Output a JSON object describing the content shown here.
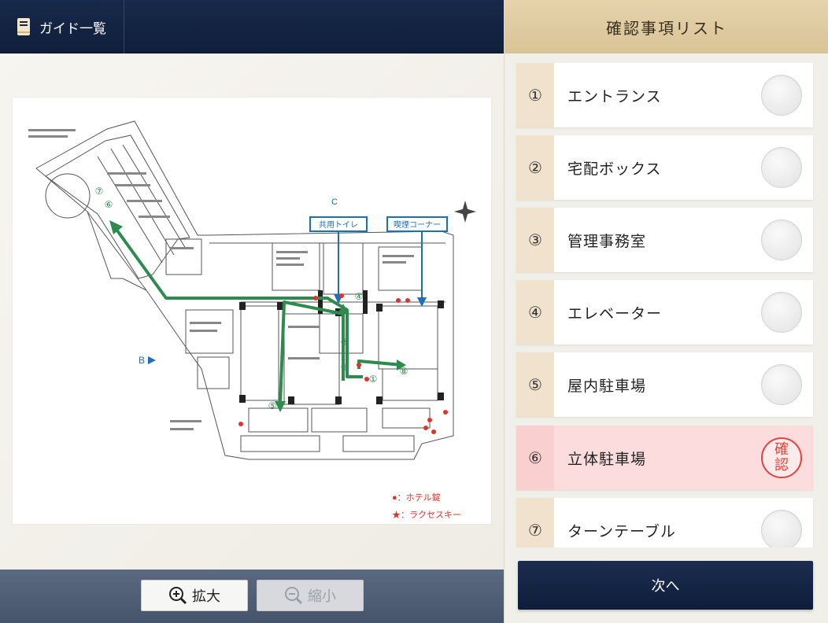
{
  "left": {
    "guide_button": "ガイド一覧",
    "guide_icon": "book-icon",
    "zoom_in": "拡大",
    "zoom_out": "縮小"
  },
  "map": {
    "label_c": "C",
    "label_b": "B",
    "toilet": "共用トイレ",
    "smoking": "喫煙コーナー",
    "legend_hotel": "●：ホテル錠",
    "legend_raku": "★：ラクセスキー",
    "markers": [
      "①",
      "②",
      "③",
      "④",
      "⑤",
      "⑥",
      "⑦",
      "⑧"
    ],
    "accent_green": "#2e8b4e",
    "accent_blue": "#1d6fb8",
    "accent_red": "#e0332b"
  },
  "right": {
    "title": "確認事項リスト",
    "items": [
      {
        "num": "①",
        "label": "エントランス",
        "checked": false
      },
      {
        "num": "②",
        "label": "宅配ボックス",
        "checked": false
      },
      {
        "num": "③",
        "label": "管理事務室",
        "checked": false
      },
      {
        "num": "④",
        "label": "エレベーター",
        "checked": false
      },
      {
        "num": "⑤",
        "label": "屋内駐車場",
        "checked": false
      },
      {
        "num": "⑥",
        "label": "立体駐車場",
        "checked": true,
        "stamp_top": "確",
        "stamp_bottom": "認"
      },
      {
        "num": "⑦",
        "label": "ターンテーブル",
        "checked": false
      }
    ],
    "next_button": "次へ"
  },
  "colors": {
    "nav_dark": "#0f1f3b",
    "header_gold": "#d9c396",
    "checked_pink": "#fcdcdc",
    "stamp_red": "#e0443c"
  }
}
